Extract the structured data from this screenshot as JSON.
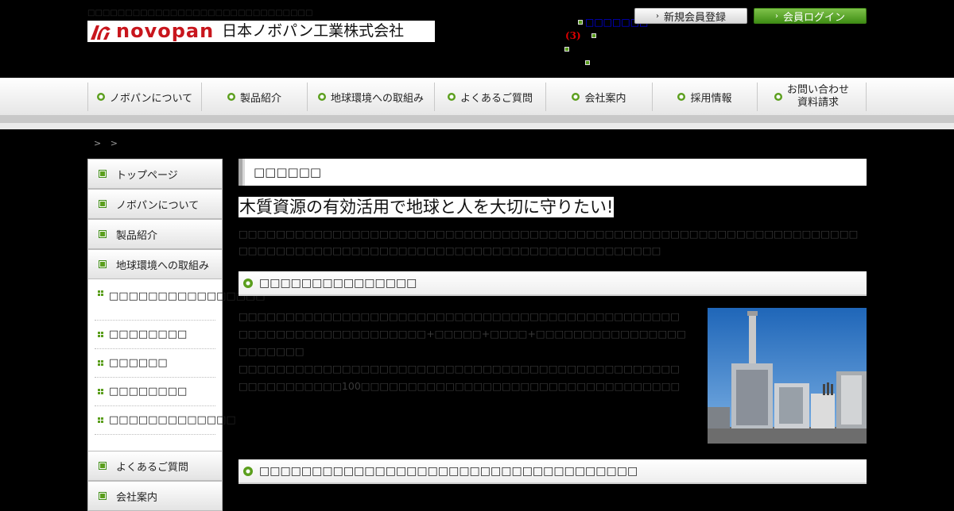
{
  "header": {
    "tagline": "□□□□□□□□□□□□□□□□□□□□□□□□□□□□□□",
    "logo_word": "novopan",
    "logo_jp": "日本ノボパン工業株式会社",
    "links": {
      "top_link": "□□□□□□□",
      "cart_count": "(3)"
    },
    "register_label": "新規会員登録",
    "login_label": "会員ログイン"
  },
  "gnav": {
    "items": [
      {
        "label": "ノボパンについて"
      },
      {
        "label": "製品紹介"
      },
      {
        "label": "地球環境への取組み"
      },
      {
        "label": "よくあるご質問"
      },
      {
        "label": "会社案内"
      },
      {
        "label": "採用情報"
      },
      {
        "label_line1": "お問い合わせ",
        "label_line2": "資料請求"
      }
    ]
  },
  "breadcrumb": "> >",
  "sidebar": {
    "main_top": [
      {
        "label": "トップページ"
      },
      {
        "label": "ノボパンについて"
      },
      {
        "label": "製品紹介"
      },
      {
        "label": "地球環境への取組み"
      }
    ],
    "sub": [
      {
        "label": "□□□□□□□□□□□□□□□□"
      },
      {
        "label": "□□□□□□□□"
      },
      {
        "label": "□□□□□□"
      },
      {
        "label": "□□□□□□□□"
      },
      {
        "label": "□□□□□□□□□□□□□"
      }
    ],
    "main_bottom": [
      {
        "label": "よくあるご質問"
      },
      {
        "label": "会社案内"
      }
    ]
  },
  "main": {
    "page_title": "□□□□□□",
    "lead": "木質資源の有効活用で地球と人を大切に守りたい!",
    "intro": "□□□□□□□□□□□□□□□□□□□□□□□□□□□□□□□□□□□□□□□□□□□□□□□□□□□□□□□□□□□□□□□□□□□□□□□□□□□□□□□□□□□□□□□□□□□□□□□□□□□□□□□□□□□□□□□",
    "section1": {
      "heading": "□□□□□□□□□□□□□□□",
      "line1": "□□□□□□□□□□□□□□□□□□□□□□□□□□□□□□□□□□□□□□□□□□□□□□□□□□□□□□□□□□□□□□□□□□□+□□□□□+□□□□+□□□□□□□□□□□□□□□□□□□□□□□",
      "line2": "□□□□□□□□□□□□□□□□□□□□□□□□□□□□□□□□□□□□□□□□□□□□□□□□□□□□□□□□□□100□□□□□□□□□□□□□□□□□□□□□□□□□□□□□□□□□□"
    },
    "section2": {
      "heading": "□□□□□□□□□□□□□□□□□□□□□□□□□□□□□□□□□□□□"
    }
  },
  "colors": {
    "accent_green": "#5a9e1c",
    "logo_red": "#c8161d",
    "background": "#000000"
  }
}
